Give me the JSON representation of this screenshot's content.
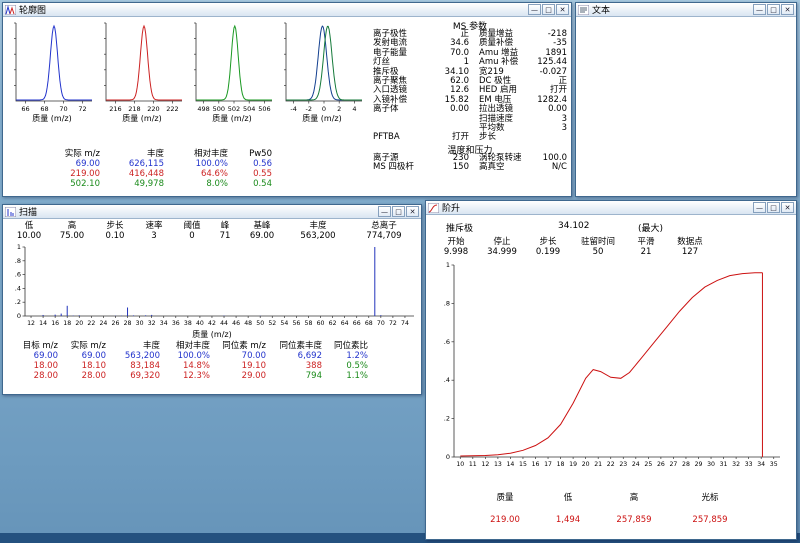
{
  "window_buttons": {
    "minimize": "—",
    "maximize": "□",
    "close": "✕"
  },
  "profile_window": {
    "title": "轮廓图",
    "plots": [
      {
        "xlabel": "质量 (m/z)",
        "x_range": [
          65,
          73
        ],
        "tick_vals": [
          66,
          68,
          70,
          72
        ],
        "ticks": [
          "66",
          "68",
          "70",
          "72"
        ],
        "peaks": [
          {
            "center": 69,
            "sigma": 0.38,
            "color": "#2233cc"
          }
        ]
      },
      {
        "xlabel": "质量 (m/z)",
        "x_range": [
          215,
          223
        ],
        "tick_vals": [
          216,
          218,
          220,
          222
        ],
        "ticks": [
          "216",
          "218",
          "220",
          "222"
        ],
        "peaks": [
          {
            "center": 219,
            "sigma": 0.38,
            "color": "#cc2222"
          }
        ]
      },
      {
        "xlabel": "质量 (m/z)",
        "x_range": [
          497,
          507
        ],
        "tick_vals": [
          498,
          500,
          502,
          504,
          506
        ],
        "ticks": [
          "498",
          "500",
          "502",
          "504",
          "506"
        ],
        "peaks": [
          {
            "center": 502.1,
            "sigma": 0.45,
            "color": "#1a9922"
          }
        ]
      },
      {
        "xlabel": "质量 (m/z)",
        "x_range": [
          -5,
          5
        ],
        "tick_vals": [
          -4,
          -2,
          0,
          2,
          4
        ],
        "ticks": [
          "-4",
          "-2",
          "0",
          "2",
          "4"
        ],
        "peaks": [
          {
            "center": -0.2,
            "sigma": 0.55,
            "color": "#123f8f"
          },
          {
            "center": 0.5,
            "sigma": 0.55,
            "color": "#157a3a"
          }
        ]
      }
    ],
    "ms_params": {
      "title": "MS 参数",
      "rows": [
        [
          "离子极性",
          "正",
          "质量增益",
          "-218"
        ],
        [
          "发射电流",
          "34.6",
          "质量补偿",
          "-35"
        ],
        [
          "电子能量",
          "70.0",
          "Amu 增益",
          "1891"
        ],
        [
          "灯丝",
          "1",
          "Amu 补偿",
          "125.44"
        ],
        [
          "推斥极",
          "34.10",
          "宽219",
          "-0.027"
        ],
        [
          "离子聚焦",
          "62.0",
          "DC 极性",
          "正"
        ],
        [
          "入口透镜",
          "12.6",
          "HED 启用",
          "打开"
        ],
        [
          "入镜补偿",
          "15.82",
          "EM 电压",
          "1282.4"
        ],
        [
          "离子体",
          "0.00",
          "拉出透镜",
          "0.00"
        ],
        [
          "",
          "",
          "扫描速度",
          "3"
        ],
        [
          "",
          "",
          "平均数",
          "3"
        ],
        [
          "PFTBA",
          "打开",
          "步长",
          ""
        ]
      ]
    },
    "temp_pressure": {
      "title": "温度和压力",
      "rows": [
        [
          "离子源",
          "230",
          "涡轮泵转速",
          "100.0"
        ],
        [
          "MS 四极杆",
          "150",
          "高真空",
          "N/C"
        ]
      ]
    },
    "peak_table": {
      "headers": [
        "实际 m/z",
        "丰度",
        "相对丰度",
        "Pw50"
      ],
      "rows": [
        {
          "cells": [
            "69.00",
            "626,115",
            "100.0%",
            "0.56"
          ],
          "color": "#2233cc"
        },
        {
          "cells": [
            "219.00",
            "416,448",
            "64.6%",
            "0.55"
          ],
          "color": "#cc2222"
        },
        {
          "cells": [
            "502.10",
            "49,978",
            "8.0%",
            "0.54"
          ],
          "color": "#1a8a1a"
        }
      ]
    }
  },
  "text_window": {
    "title": "文本"
  },
  "scan_window": {
    "title": "扫描",
    "header": {
      "labels": [
        "低",
        "高",
        "步长",
        "速率",
        "阈值",
        "峰",
        "基峰",
        "丰度",
        "总离子"
      ],
      "values": [
        "10.00",
        "75.00",
        "0.10",
        "3",
        "0",
        "71",
        "69.00",
        "563,200",
        "774,709"
      ]
    },
    "xlabel": "质量 (m/z)",
    "chart_data": {
      "type": "bar",
      "x_range": [
        11,
        75.5
      ],
      "x_ticks": [
        12,
        14,
        16,
        18,
        20,
        22,
        24,
        26,
        28,
        30,
        32,
        34,
        36,
        38,
        40,
        42,
        44,
        46,
        48,
        50,
        52,
        54,
        56,
        58,
        60,
        62,
        64,
        66,
        68,
        70,
        72,
        74
      ],
      "y_ticks": [
        0,
        0.2,
        0.4,
        0.6,
        0.8,
        1
      ],
      "y_tick_labels": [
        "0",
        ".2",
        ".4",
        ".6",
        ".8",
        "1"
      ],
      "color": "#2233bb",
      "peaks": [
        [
          14,
          0.015
        ],
        [
          16,
          0.02
        ],
        [
          17,
          0.035
        ],
        [
          18,
          0.148
        ],
        [
          19,
          0.006
        ],
        [
          20,
          0.01
        ],
        [
          26,
          0.004
        ],
        [
          27,
          0.006
        ],
        [
          28,
          0.123
        ],
        [
          29,
          0.009
        ],
        [
          31,
          0.01
        ],
        [
          32,
          0.016
        ],
        [
          44,
          0.006
        ],
        [
          50,
          0.004
        ],
        [
          69,
          1.0
        ],
        [
          70,
          0.012
        ]
      ]
    },
    "table": {
      "headers": [
        "目标 m/z",
        "实际 m/z",
        "丰度",
        "相对丰度",
        "同位素 m/z",
        "同位素丰度",
        "同位素比"
      ],
      "rows": [
        {
          "cells": [
            "69.00",
            "69.00",
            "563,200",
            "100.0%",
            "70.00",
            "6,692",
            "1.2%"
          ],
          "colors": [
            "#2233cc",
            "#2233cc",
            "#2233cc",
            "#2233cc",
            "#2233cc",
            "#2233cc",
            "#2233cc"
          ]
        },
        {
          "cells": [
            "18.00",
            "18.10",
            "83,184",
            "14.8%",
            "19.10",
            "388",
            "0.5%"
          ],
          "colors": [
            "#cc2222",
            "#cc2222",
            "#cc2222",
            "#cc2222",
            "#cc2222",
            "#cc2222",
            "#1a8a1a"
          ]
        },
        {
          "cells": [
            "28.00",
            "28.00",
            "69,320",
            "12.3%",
            "29.00",
            "794",
            "1.1%"
          ],
          "colors": [
            "#cc2222",
            "#cc2222",
            "#cc2222",
            "#cc2222",
            "#cc2222",
            "#1a8a1a",
            "#1a8a1a"
          ]
        }
      ]
    }
  },
  "ramp_window": {
    "title": "阶升",
    "param_name": "推斥极",
    "param_value": "34.102",
    "param_note": "(最大)",
    "header": {
      "labels": [
        "开始",
        "停止",
        "步长",
        "驻留时间",
        "平滑",
        "数据点"
      ],
      "values": [
        "9.998",
        "34.999",
        "0.199",
        "50",
        "21",
        "127"
      ]
    },
    "bottom": {
      "headers": [
        "质量",
        "低",
        "高",
        "光标"
      ],
      "values": [
        "219.00",
        "1,494",
        "257,859",
        "257,859"
      ]
    },
    "chart_data": {
      "type": "line",
      "x_range": [
        9.5,
        35.5
      ],
      "x_ticks": [
        10,
        11,
        12,
        13,
        14,
        15,
        16,
        17,
        18,
        19,
        20,
        21,
        22,
        23,
        24,
        25,
        26,
        27,
        28,
        29,
        30,
        31,
        32,
        33,
        34,
        35
      ],
      "y_ticks": [
        0,
        0.2,
        0.4,
        0.6,
        0.8,
        1
      ],
      "y_tick_labels": [
        "0",
        ".2",
        ".4",
        ".6",
        ".8",
        "1"
      ],
      "color": "#cc1111",
      "points": [
        [
          10,
          0.005
        ],
        [
          11,
          0.006
        ],
        [
          12,
          0.008
        ],
        [
          13,
          0.012
        ],
        [
          14,
          0.02
        ],
        [
          15,
          0.035
        ],
        [
          16,
          0.06
        ],
        [
          17,
          0.1
        ],
        [
          18,
          0.17
        ],
        [
          19,
          0.28
        ],
        [
          20,
          0.41
        ],
        [
          20.6,
          0.455
        ],
        [
          21.2,
          0.445
        ],
        [
          22,
          0.415
        ],
        [
          22.8,
          0.41
        ],
        [
          23.5,
          0.44
        ],
        [
          24.5,
          0.52
        ],
        [
          25.5,
          0.6
        ],
        [
          26.5,
          0.68
        ],
        [
          27.5,
          0.76
        ],
        [
          28.5,
          0.83
        ],
        [
          29.5,
          0.885
        ],
        [
          30.5,
          0.92
        ],
        [
          31.5,
          0.945
        ],
        [
          32.5,
          0.955
        ],
        [
          33.5,
          0.96
        ],
        [
          34.1,
          0.96
        ]
      ],
      "cursor_x": 34.1,
      "cursor_y": 0.96
    }
  }
}
